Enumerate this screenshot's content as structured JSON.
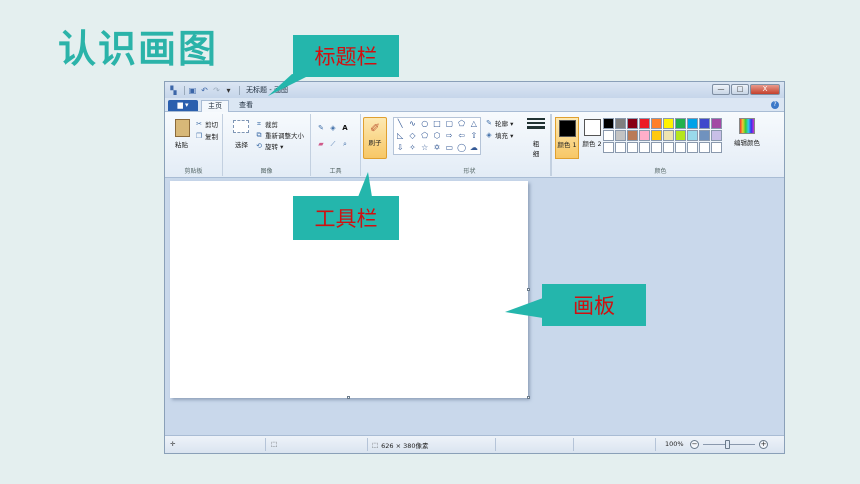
{
  "slide": {
    "title": "认识画图"
  },
  "callouts": {
    "titlebar": "标题栏",
    "toolbar": "工具栏",
    "canvas": "画板"
  },
  "window": {
    "title": "无标题 - 画图",
    "controls": {
      "minimize": "—",
      "maximize": "□",
      "close": "X"
    }
  },
  "tabs": {
    "file": "▆ ▾",
    "home": "主页",
    "view": "查看"
  },
  "ribbon": {
    "clipboard": {
      "paste": "粘贴",
      "cut": "剪切",
      "copy": "复制",
      "label": "剪贴板"
    },
    "image": {
      "select": "选择",
      "crop": "裁剪",
      "resize": "重新调整大小",
      "rotate": "旋转 ▾",
      "label": "图像"
    },
    "tools": {
      "label": "工具"
    },
    "brushes": {
      "label": "刷子"
    },
    "shapes": {
      "outline": "轮廓 ▾",
      "fill": "填充 ▾",
      "label": "形状"
    },
    "size": {
      "label": "粗细"
    },
    "colors": {
      "color1": "颜色 1",
      "color2": "颜色 2",
      "edit": "编辑颜色",
      "label": "颜色"
    }
  },
  "palette_colors": [
    "#000000",
    "#7f7f7f",
    "#880015",
    "#ed1c24",
    "#ff7f27",
    "#fff200",
    "#22b14c",
    "#00a2e8",
    "#3f48cc",
    "#a349a4",
    "#ffffff",
    "#c3c3c3",
    "#b97a57",
    "#ffaec9",
    "#ffc90e",
    "#efe4b0",
    "#b5e61d",
    "#99d9ea",
    "#7092be",
    "#c8bfe7",
    "#ffffff",
    "#ffffff",
    "#ffffff",
    "#ffffff",
    "#ffffff",
    "#ffffff",
    "#ffffff",
    "#ffffff",
    "#ffffff",
    "#ffffff"
  ],
  "status": {
    "dimensions": "626 × 380像素",
    "zoom": "100%"
  }
}
